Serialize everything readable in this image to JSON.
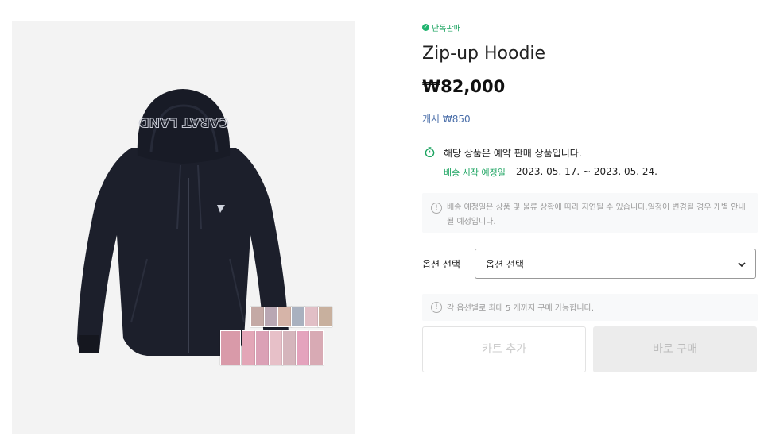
{
  "badge": {
    "text": "단독판매",
    "color": "#1aa35f"
  },
  "product": {
    "title": "Zip-up Hoodie",
    "price": "₩82,000",
    "cash": "캐시 ₩850"
  },
  "preorder": {
    "notice": "해당 상품은 예약 판매 상품입니다.",
    "ship_label": "배송 시작 예정일",
    "ship_dates": "2023. 05. 17. ~ 2023. 05. 24."
  },
  "info_box": {
    "text": "배송 예정일은 상품 및 물류 상황에 따라 지연될 수 있습니다.일정이 변경될 경우 개별 안내될 예정입니다."
  },
  "option": {
    "label": "옵션 선택",
    "selected": "옵션 선택"
  },
  "limit": {
    "text": "각 옵션별로 최대 5 개까지 구매 가능합니다."
  },
  "buttons": {
    "cart": "카트 추가",
    "buy": "바로 구매"
  },
  "hoodie_print": "CARAT LAND",
  "icons": {
    "badge": "check-circle-icon",
    "notice": "clock-icon",
    "info": "info-circle-icon",
    "dropdown": "chevron-down-icon"
  },
  "colors": {
    "accent": "#1aa35f",
    "hoodie": "#1c1f2b",
    "cash_link": "#4a6ea9"
  }
}
